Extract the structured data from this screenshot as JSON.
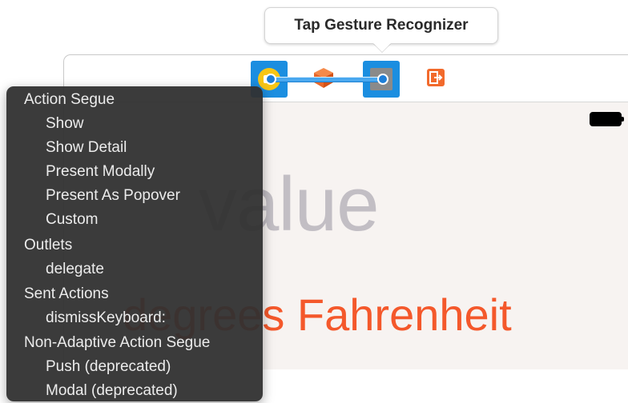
{
  "tooltip": {
    "text": "Tap Gesture Recognizer"
  },
  "scene": {
    "value_label": "value",
    "units_label": "degrees Fahrenheit",
    "colors": {
      "value": "#c2bec4",
      "units": "#f4582b",
      "view_background": "#f7f3f1"
    },
    "dock_icons": [
      "view-controller-icon",
      "first-responder-icon",
      "tap-gesture-recognizer-icon",
      "exit-icon"
    ]
  },
  "menu": {
    "sections": [
      {
        "header": "Action Segue",
        "items": [
          "Show",
          "Show Detail",
          "Present Modally",
          "Present As Popover",
          "Custom"
        ]
      },
      {
        "header": "Outlets",
        "items": [
          "delegate"
        ]
      },
      {
        "header": "Sent Actions",
        "items": [
          "dismissKeyboard:"
        ]
      },
      {
        "header": "Non-Adaptive Action Segue",
        "items": [
          "Push (deprecated)",
          "Modal (deprecated)"
        ]
      }
    ]
  }
}
